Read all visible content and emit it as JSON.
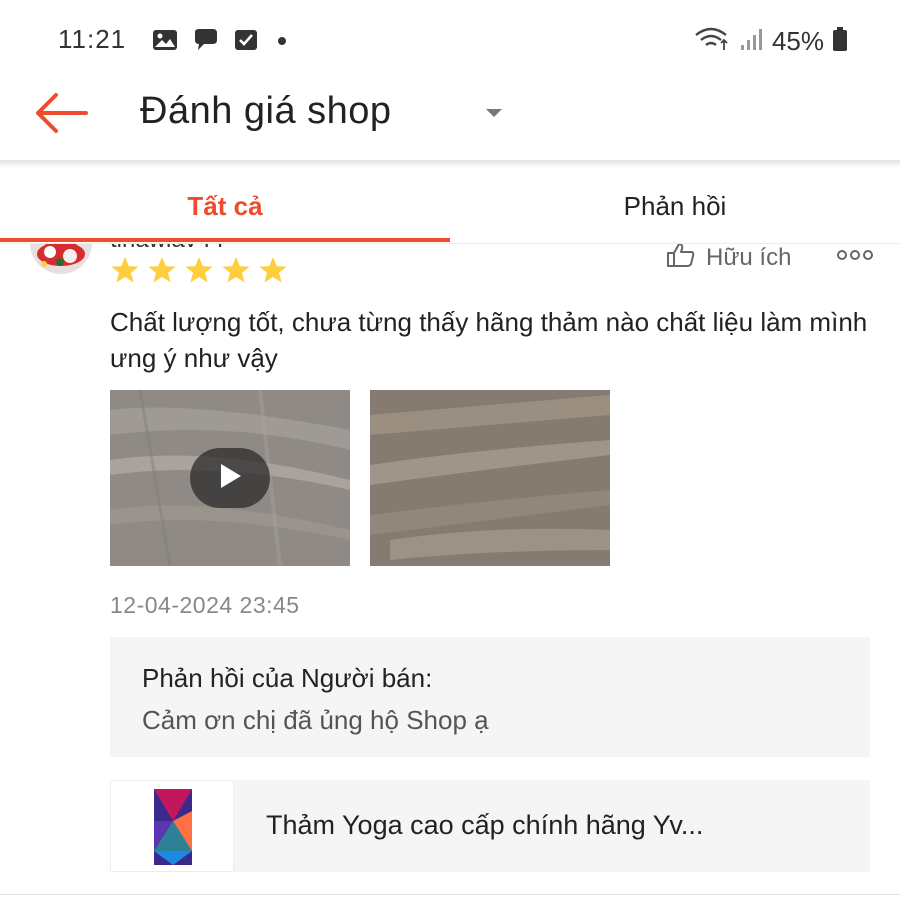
{
  "status_bar": {
    "time": "11:21",
    "battery": "45%",
    "left_icons": [
      "image-icon",
      "chat-bubble-icon",
      "checkbox-icon",
      "dot-icon"
    ],
    "right_icons": [
      "wifi-icon",
      "signal-icon",
      "battery-icon"
    ]
  },
  "header": {
    "title": "Đánh giá shop",
    "back_icon": "arrow-left-icon",
    "dropdown_icon": "caret-down-icon"
  },
  "tabs": [
    {
      "label": "Tất cả",
      "active": true
    },
    {
      "label": "Phản hồi",
      "active": false
    }
  ],
  "review": {
    "username": "tinawiav I I",
    "rating": 5,
    "helpful_label": "Hữu ích",
    "text": "Chất lượng tốt, chưa từng thấy hãng thảm nào chất liệu làm mình ưng ý như vậy",
    "media": [
      {
        "type": "video"
      },
      {
        "type": "image"
      }
    ],
    "date": "12-04-2024 23:45",
    "seller_reply": {
      "title": "Phản hồi của Người bán:",
      "text": "Cảm ơn chị đã ủng hộ Shop ạ"
    },
    "product": {
      "name": "Thảm Yoga cao cấp chính hãng Yv..."
    }
  },
  "colors": {
    "accent": "#ee4d2d",
    "star": "#ffce3d",
    "panel": "#f5f5f5"
  }
}
